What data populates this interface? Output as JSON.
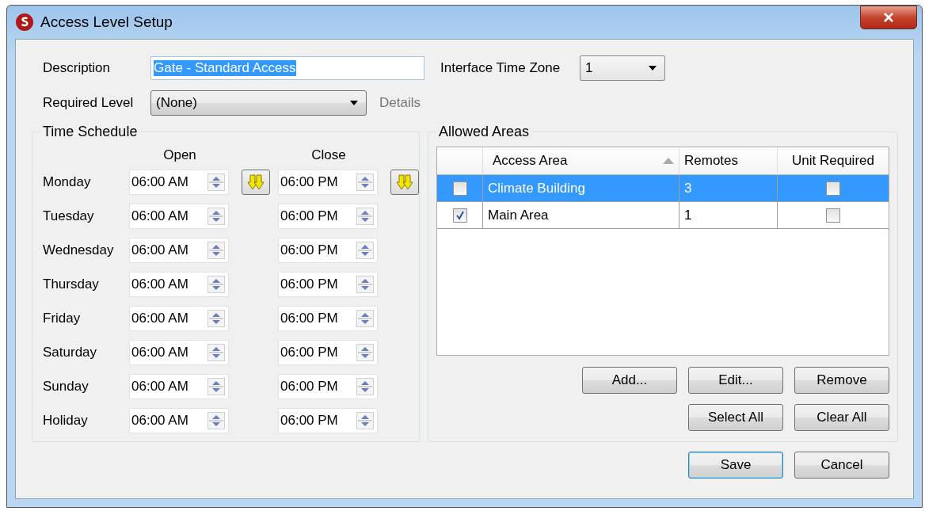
{
  "window": {
    "title": "Access Level Setup"
  },
  "description": {
    "label": "Description",
    "value": "Gate - Standard Access",
    "text_selected": true
  },
  "interface_time_zone": {
    "label": "Interface Time Zone",
    "value": "1"
  },
  "required_level": {
    "label": "Required Level",
    "value": "(None)",
    "details_link": "Details"
  },
  "time_schedule": {
    "title": "Time Schedule",
    "open_heading": "Open",
    "close_heading": "Close",
    "rows": [
      {
        "day": "Monday",
        "open": "06:00 AM",
        "close": "06:00 PM",
        "fill_down": true
      },
      {
        "day": "Tuesday",
        "open": "06:00 AM",
        "close": "06:00 PM",
        "fill_down": false
      },
      {
        "day": "Wednesday",
        "open": "06:00 AM",
        "close": "06:00 PM",
        "fill_down": false
      },
      {
        "day": "Thursday",
        "open": "06:00 AM",
        "close": "06:00 PM",
        "fill_down": false
      },
      {
        "day": "Friday",
        "open": "06:00 AM",
        "close": "06:00 PM",
        "fill_down": false
      },
      {
        "day": "Saturday",
        "open": "06:00 AM",
        "close": "06:00 PM",
        "fill_down": false
      },
      {
        "day": "Sunday",
        "open": "06:00 AM",
        "close": "06:00 PM",
        "fill_down": false
      },
      {
        "day": "Holiday",
        "open": "06:00 AM",
        "close": "06:00 PM",
        "fill_down": false
      }
    ]
  },
  "allowed_areas": {
    "title": "Allowed Areas",
    "columns": [
      "Access Area",
      "Remotes",
      "Unit Required"
    ],
    "rows": [
      {
        "checked": false,
        "area": "Climate Building",
        "remotes": "3",
        "unit_required": false,
        "selected": true
      },
      {
        "checked": true,
        "area": "Main Area",
        "remotes": "1",
        "unit_required": false,
        "selected": false
      }
    ],
    "buttons": [
      [
        "Add...",
        "Edit...",
        "Remove"
      ],
      [
        "Select All",
        "Clear All"
      ]
    ]
  },
  "footer_buttons": [
    {
      "label": "Save",
      "default": true
    },
    {
      "label": "Cancel",
      "default": false
    }
  ]
}
